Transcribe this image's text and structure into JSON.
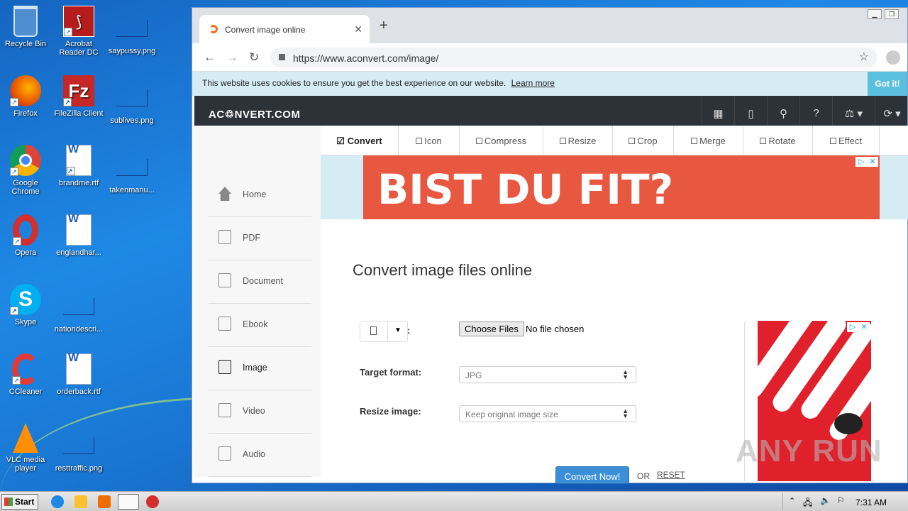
{
  "desktop": {
    "icons": [
      {
        "label": "Recycle Bin"
      },
      {
        "label": "Acrobat Reader DC"
      },
      {
        "label": "saypussy.png"
      },
      {
        "label": "Firefox"
      },
      {
        "label": "FileZilla Client"
      },
      {
        "label": "sublives.png"
      },
      {
        "label": "Google Chrome"
      },
      {
        "label": "brandme.rtf"
      },
      {
        "label": "takenmanu..."
      },
      {
        "label": "Opera"
      },
      {
        "label": "englandhar..."
      },
      {
        "label": "Skype"
      },
      {
        "label": "nationdescri..."
      },
      {
        "label": "CCleaner"
      },
      {
        "label": "orderback.rtf"
      },
      {
        "label": "VLC media player"
      },
      {
        "label": "resttraffic.png"
      }
    ]
  },
  "browser": {
    "tab_title": "Convert image online",
    "url": "https://www.aconvert.com/image/",
    "cookie_text": "This website uses cookies to ensure you get the best experience on our website.",
    "cookie_link": "Learn more",
    "cookie_button": "Got it!"
  },
  "site": {
    "logo": "AC♲NVERT.COM",
    "sidebar": [
      {
        "label": "Home"
      },
      {
        "label": "PDF"
      },
      {
        "label": "Document"
      },
      {
        "label": "Ebook"
      },
      {
        "label": "Image"
      },
      {
        "label": "Video"
      },
      {
        "label": "Audio"
      }
    ],
    "subtabs": [
      {
        "label": "Convert"
      },
      {
        "label": "Icon"
      },
      {
        "label": "Compress"
      },
      {
        "label": "Resize"
      },
      {
        "label": "Crop"
      },
      {
        "label": "Merge"
      },
      {
        "label": "Rotate"
      },
      {
        "label": "Effect"
      }
    ],
    "ad_text": "BIST DU FIT?",
    "page_title": "Convert image files online",
    "form": {
      "file_colon": ":",
      "choose_files": "Choose Files",
      "no_file": "No file chosen",
      "target_format_label": "Target format:",
      "target_format_value": "JPG",
      "resize_label": "Resize image:",
      "resize_value": "Keep original image size",
      "convert_button": "Convert Now!",
      "or_text": "OR",
      "reset_text": "RESET"
    },
    "watermark": "ANY RUN"
  },
  "taskbar": {
    "start_label": "Start",
    "clock": "7:31 AM"
  },
  "colors": {
    "header_bg": "#2d3138",
    "ad_bg": "#e8573f",
    "accent_blue": "#3b8fd9",
    "cookie_bg": "#d6ecf5"
  }
}
